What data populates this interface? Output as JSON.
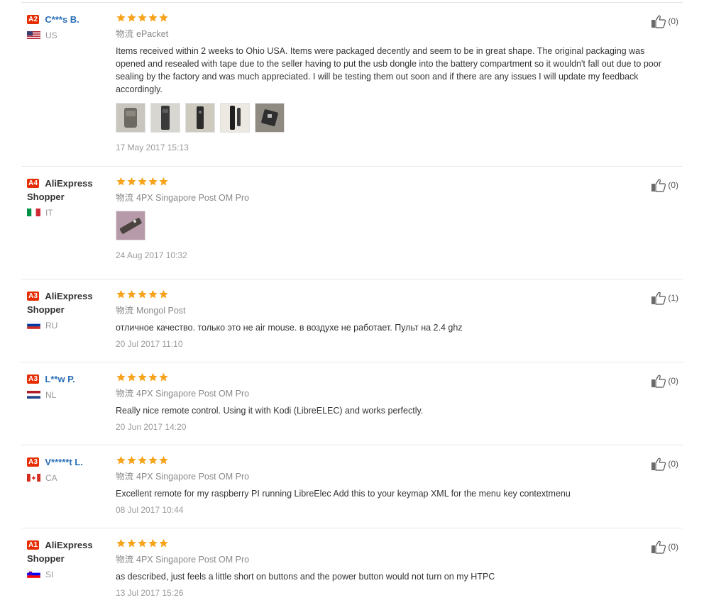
{
  "logistics_label": "物流",
  "colors": {
    "accent_red": "#e62e04",
    "star": "#f7a31c",
    "link_blue": "#2a6fb7"
  },
  "reviews": [
    {
      "level": "A2",
      "name": "C***s B.",
      "country": "US",
      "rating": 5,
      "shipping": "ePacket",
      "text": "Items received within 2 weeks to Ohio USA. Items were packaged decently and seem to be in great shape. The original packaging was opened and resealed with tape due to the seller having to put the usb dongle into the battery compartment so it wouldn't fall out due to poor sealing by the factory and was much appreciated. I will be testing them out soon and if there are any issues I will update my feedback accordingly.",
      "photo_count": 5,
      "date": "17 May 2017 15:13",
      "helpful": "(0)"
    },
    {
      "level": "A4",
      "name": "AliExpress Shopper",
      "country": "IT",
      "rating": 5,
      "shipping": "4PX Singapore Post OM Pro",
      "text": "",
      "photo_count": 1,
      "date": "24 Aug 2017 10:32",
      "helpful": "(0)"
    },
    {
      "level": "A3",
      "name": "AliExpress Shopper",
      "country": "RU",
      "rating": 5,
      "shipping": "Mongol Post",
      "text": "отличное качество. только это не air mouse. в воздухе не работает. Пульт на 2.4 ghz",
      "photo_count": 0,
      "date": "20 Jul 2017 11:10",
      "helpful": "(1)"
    },
    {
      "level": "A3",
      "name": "L**w P.",
      "country": "NL",
      "rating": 5,
      "shipping": "4PX Singapore Post OM Pro",
      "text": "Really nice remote control. Using it with Kodi (LibreELEC) and works perfectly.",
      "photo_count": 0,
      "date": "20 Jun 2017 14:20",
      "helpful": "(0)"
    },
    {
      "level": "A3",
      "name": "V*****t L.",
      "country": "CA",
      "rating": 5,
      "shipping": "4PX Singapore Post OM Pro",
      "text": "Excellent remote for my raspberry PI running LibreElec Add this to your keymap XML for the menu key contextmenu",
      "photo_count": 0,
      "date": "08 Jul 2017 10:44",
      "helpful": "(0)"
    },
    {
      "level": "A1",
      "name": "AliExpress Shopper",
      "country": "SI",
      "rating": 5,
      "shipping": "4PX Singapore Post OM Pro",
      "text": "as described, just feels a little short on buttons and the power button would not turn on my HTPC",
      "photo_count": 0,
      "date": "13 Jul 2017 15:26",
      "helpful": "(0)"
    }
  ]
}
